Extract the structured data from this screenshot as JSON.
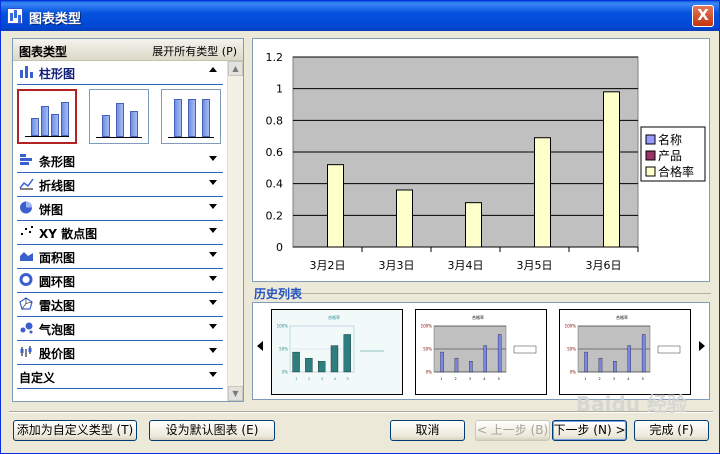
{
  "window": {
    "title": "图表类型",
    "close_label": "X"
  },
  "left_panel": {
    "title": "图表类型",
    "expand_label": "展开所有类型 (P)",
    "categories": [
      {
        "label": "柱形图",
        "icon": "column-chart-icon",
        "expanded": true
      },
      {
        "label": "条形图",
        "icon": "bar-chart-icon"
      },
      {
        "label": "折线图",
        "icon": "line-chart-icon"
      },
      {
        "label": "饼图",
        "icon": "pie-chart-icon"
      },
      {
        "label": "XY 散点图",
        "icon": "scatter-chart-icon"
      },
      {
        "label": "面积图",
        "icon": "area-chart-icon"
      },
      {
        "label": "圆环图",
        "icon": "doughnut-chart-icon"
      },
      {
        "label": "雷达图",
        "icon": "radar-chart-icon"
      },
      {
        "label": "气泡图",
        "icon": "bubble-chart-icon"
      },
      {
        "label": "股价图",
        "icon": "stock-chart-icon"
      },
      {
        "label": "自定义",
        "icon": ""
      }
    ]
  },
  "history": {
    "label": "历史列表",
    "thumb_titles": [
      "合格率",
      "合格率",
      "合格率"
    ]
  },
  "chart_data": {
    "type": "bar",
    "categories": [
      "3月2日",
      "3月3日",
      "3月4日",
      "3月5日",
      "3月6日"
    ],
    "series": [
      {
        "name": "名称",
        "values": [
          0,
          0,
          0,
          0,
          0
        ],
        "color": "#9999ff"
      },
      {
        "name": "产品",
        "values": [
          0,
          0,
          0,
          0,
          0
        ],
        "color": "#993366"
      },
      {
        "name": "合格率",
        "values": [
          0.52,
          0.36,
          0.28,
          0.69,
          0.98
        ],
        "color": "#ffffcc"
      }
    ],
    "yticks": [
      "0",
      "0.2",
      "0.4",
      "0.6",
      "0.8",
      "1",
      "1.2"
    ],
    "ylim": [
      0,
      1.2
    ],
    "grid": true,
    "plot_background": "#c0c0c0",
    "legend_position": "right"
  },
  "buttons": {
    "add_custom": "添加为自定义类型 (T)",
    "set_default": "设为默认图表 (E)",
    "cancel": "取消",
    "back": "< 上一步 (B)",
    "next": "下一步 (N) >",
    "finish": "完成 (F)"
  },
  "watermark": "Baidu 经验"
}
